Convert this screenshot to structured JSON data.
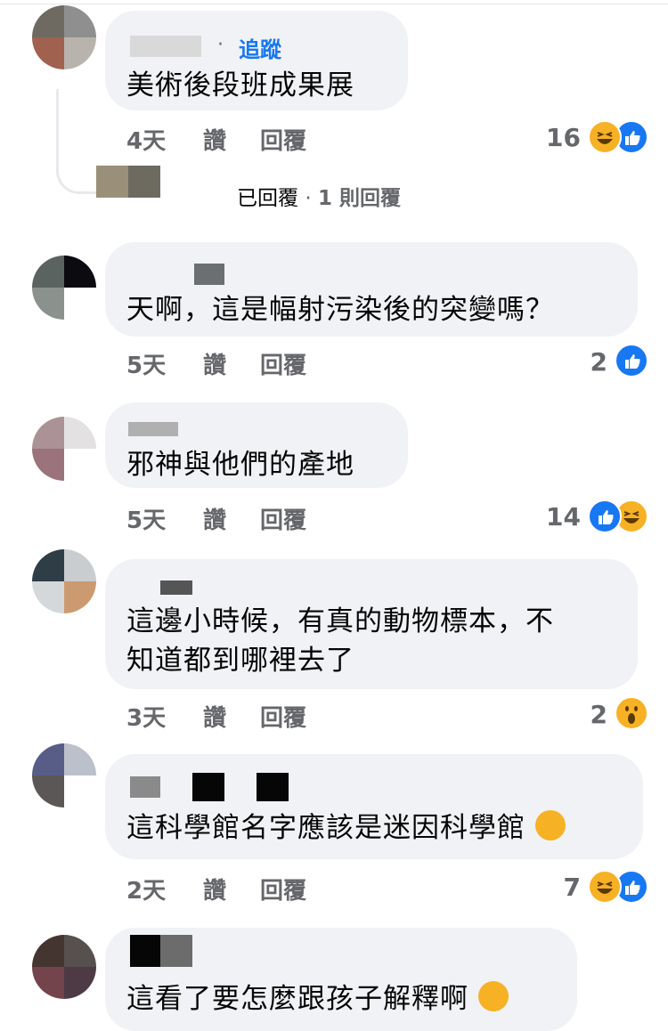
{
  "comments": [
    {
      "follow": "追蹤",
      "text": "美術後段班成果展",
      "time": "4天",
      "like": "讚",
      "reply": "回覆",
      "count": "16",
      "reactions": [
        "haha-icon",
        "like-icon"
      ]
    },
    {
      "text": "天啊，這是幅射污染後的突變嗎？",
      "time": "5天",
      "like": "讚",
      "reply": "回覆",
      "count": "2",
      "reactions": [
        "like-icon"
      ]
    },
    {
      "text": "邪神與他們的產地",
      "time": "5天",
      "like": "讚",
      "reply": "回覆",
      "count": "14",
      "reactions": [
        "like-icon",
        "haha-icon"
      ]
    },
    {
      "text_line1": "這邊小時候，有真的動物標本，不",
      "text_line2": "知道都到哪裡去了",
      "time": "3天",
      "like": "讚",
      "reply": "回覆",
      "count": "2",
      "reactions": [
        "wow-icon"
      ]
    },
    {
      "text": "這科學館名字應該是迷因科學館",
      "time": "2天",
      "like": "讚",
      "reply": "回覆",
      "count": "7",
      "reactions": [
        "cry-laugh-icon",
        "haha-icon",
        "like-icon"
      ]
    },
    {
      "text": "這看了要怎麼跟孩子解釋啊",
      "reactions": [
        "rofl-icon"
      ]
    }
  ],
  "reply_summary": {
    "replied": "已回覆",
    "separator": "·",
    "count": "1 則回覆"
  },
  "separator": "·",
  "colors": {
    "link_blue": "#1877f2",
    "bubble_gray": "#f0f2f5",
    "meta_gray": "#65676b",
    "reaction_yellow": "#f7b125"
  }
}
